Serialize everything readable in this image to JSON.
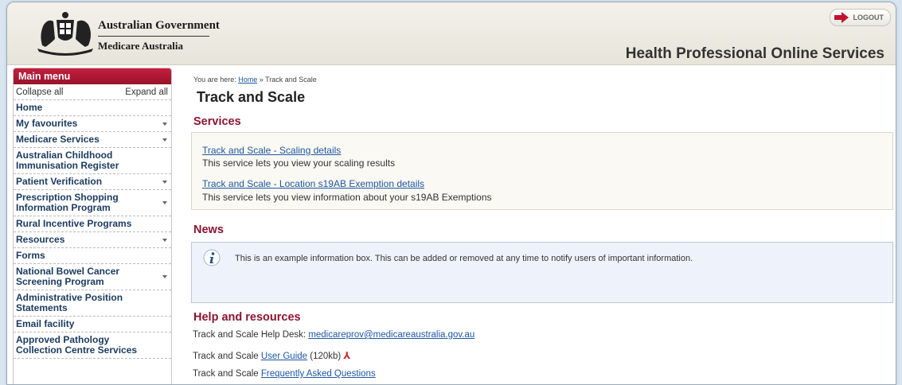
{
  "header": {
    "gov_title": "Australian Government",
    "gov_subtitle": "Medicare Australia",
    "site_title": "Health Professional Online Services",
    "logout_label": "LOGOUT"
  },
  "sidebar": {
    "title": "Main menu",
    "collapse_label": "Collapse all",
    "expand_label": "Expand all",
    "items": [
      {
        "label": "Home",
        "arrow": false
      },
      {
        "label": "My favourites",
        "arrow": true
      },
      {
        "label": "Medicare Services",
        "arrow": true
      },
      {
        "label": "Australian Childhood Immunisation Register",
        "arrow": false
      },
      {
        "label": "Patient Verification",
        "arrow": true
      },
      {
        "label": "Prescription Shopping Information Program",
        "arrow": true
      },
      {
        "label": "Rural Incentive Programs",
        "arrow": false
      },
      {
        "label": "Resources",
        "arrow": true
      },
      {
        "label": "Forms",
        "arrow": false
      },
      {
        "label": "National Bowel Cancer Screening Program",
        "arrow": true
      },
      {
        "label": "Administrative Position Statements",
        "arrow": false
      },
      {
        "label": "Email facility",
        "arrow": false
      },
      {
        "label": "Approved Pathology Collection Centre Services",
        "arrow": false
      }
    ]
  },
  "breadcrumb": {
    "prefix": "You are here: ",
    "home": "Home",
    "separator": " » ",
    "current": "Track and Scale"
  },
  "main": {
    "title": "Track and Scale",
    "services_heading": "Services",
    "services": [
      {
        "link": "Track and Scale - Scaling details",
        "desc": "This service lets you view your scaling results"
      },
      {
        "link": "Track and Scale - Location s19AB Exemption details",
        "desc": "This service lets you view information about your s19AB Exemptions"
      }
    ],
    "news_heading": "News",
    "news_text": "This is an example information box. This can be added or removed at any time to notify users of important information.",
    "help_heading": "Help and resources",
    "help": {
      "desk_prefix": "Track and Scale Help Desk: ",
      "desk_email": "medicareprov@medicareaustralia.gov.au",
      "guide_prefix": "Track and Scale ",
      "guide_link": "User Guide",
      "guide_size": " (120kb)",
      "faq_prefix": "Track and Scale ",
      "faq_link": "Frequently Asked Questions"
    }
  },
  "colors": {
    "accent": "#8a1532",
    "menu_header": "#b0183a",
    "link": "#1f57a4"
  }
}
